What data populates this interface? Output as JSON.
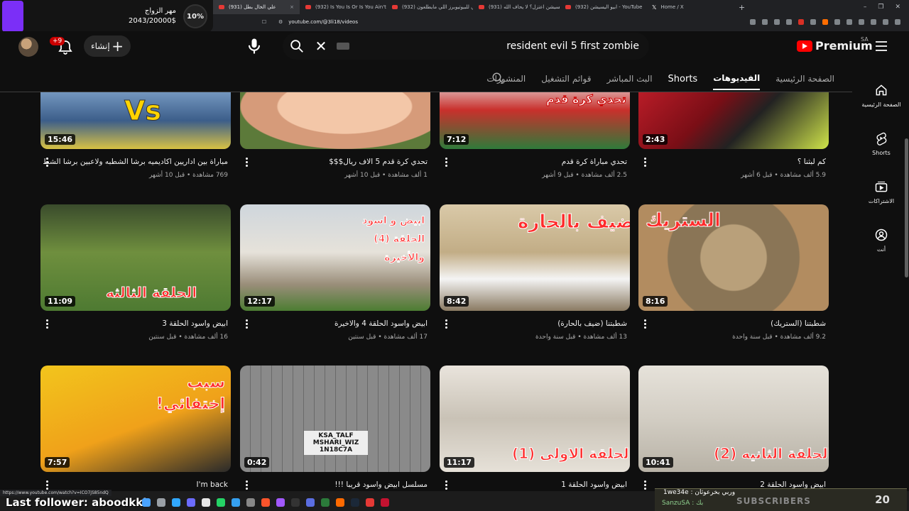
{
  "browser": {
    "tabs": [
      {
        "label": "(931) علي الخال بطل",
        "active": true
      },
      {
        "label": "(932) Is You Is Or Is You Ain't My Ba",
        "active": false
      },
      {
        "label": "(932) تقييمي للبيوتيوبرز اللي مايطلعون",
        "active": false
      },
      {
        "label": "(931) ابيو اليسيشن اعتزل؟ لا يحاف الله!",
        "active": false
      },
      {
        "label": "(932) ابيو اليسيشن - YouTube",
        "active": false
      },
      {
        "label": "Home / X",
        "active": false
      }
    ],
    "url": "youtube.com/@3li18/videos",
    "status_url": "https://www.youtube.com/watch?v=ICO7jS85ndQ"
  },
  "stream_overlay": {
    "goal_title": "مهر الزواج",
    "goal_amount": "2043/20000$",
    "goal_percent": "10%",
    "last_follower": "Last follower: aboodkkl",
    "subscribers": {
      "user1": "1we34e : وربي بخرعوثان",
      "user2": "SanzuSA : بك",
      "label": "SUBSCRIBERS",
      "count": "20"
    }
  },
  "youtube": {
    "notification_count": "+9",
    "create_label": "إنشاء",
    "search_query": "resident evil 5 first zombie",
    "logo_text": "Premium",
    "region": "SA",
    "channel_tabs": [
      "الصفحة الرئيسية",
      "الفيديوهات",
      "Shorts",
      "البث المباشر",
      "قوائم التشغيل",
      "المنشورات"
    ],
    "selected_tab": "الفيديوهات",
    "rail": [
      {
        "label": "الصفحة الرئيسية",
        "icon": "home-icon"
      },
      {
        "label": "Shorts",
        "icon": "shorts-icon"
      },
      {
        "label": "الاشتراكات",
        "icon": "subscriptions-icon"
      },
      {
        "label": "أنت",
        "icon": "you-icon"
      }
    ],
    "videos": [
      {
        "title": "مباراة بين اداريين اكاديميه برشا الشطبه ولاعبين برشا الشطبه",
        "meta": "769 مشاهدة • قبل 10 أشهر",
        "duration": "15:46",
        "thumb_text": "Vs"
      },
      {
        "title": "تحدي كرة قدم 5 الاف ريال$$$",
        "meta": "1 ألف مشاهدة • قبل 10 أشهر",
        "duration": "",
        "thumb_text": ""
      },
      {
        "title": "تحدي مباراة كرة قدم",
        "meta": "2.5 ألف مشاهدة • قبل 9 أشهر",
        "duration": "7:12",
        "thumb_text": "تحدي كرة قدم"
      },
      {
        "title": "كم لبثنا ؟",
        "meta": "5.9 ألف مشاهدة • قبل 6 أشهر",
        "duration": "2:43",
        "thumb_text": ""
      },
      {
        "title": "ابيض واسود الحلقة 3",
        "meta": "16 ألف مشاهدة • قبل سنتين",
        "duration": "11:09",
        "thumb_text": "الحلقة الثالثه"
      },
      {
        "title": "ابيض واسود الحلقة 4 والاخيرة",
        "meta": "17 ألف مشاهدة • قبل سنتين",
        "duration": "12:17",
        "thumb_text": "ابيض و اسود الحلقة (4) والأخيرة"
      },
      {
        "title": "شطبتنا (ضيف بالحارة)",
        "meta": "13 ألف مشاهدة • قبل سنة واحدة",
        "duration": "8:42",
        "thumb_text": "ضيف بالحارة"
      },
      {
        "title": "شطبتنا (الستريك)",
        "meta": "9.2 ألف مشاهدة • قبل سنة واحدة",
        "duration": "8:16",
        "thumb_text": "الستريك"
      },
      {
        "title": "I'm back",
        "meta": "",
        "duration": "7:57",
        "thumb_text": "سبب إختفائي!"
      },
      {
        "title": "مسلسل ابيض واسود قريبا !!!",
        "meta": "",
        "duration": "0:42",
        "thumb_text": "KSA_TALF MSHARI_WIZ 1N18C7A"
      },
      {
        "title": "ابيض واسود الحلقة 1",
        "meta": "",
        "duration": "11:17",
        "thumb_text": "الحلقة الاولى (1)"
      },
      {
        "title": "ابيض واسود الحلقة 2",
        "meta": "",
        "duration": "10:41",
        "thumb_text": "الحلقة الثانيه (2)"
      }
    ]
  }
}
